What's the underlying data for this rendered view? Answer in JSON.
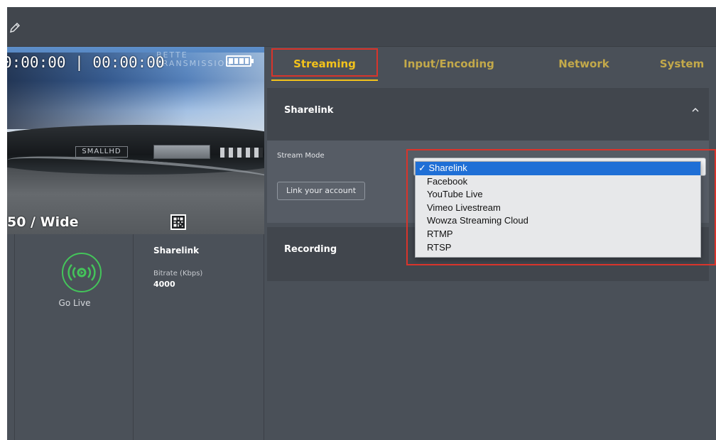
{
  "colors": {
    "accent": "#f2c21c",
    "tab_inactive": "#c3a94a",
    "live_green": "#44c45a",
    "highlight_red": "#d9342b",
    "selected_blue": "#1f6fd6"
  },
  "toolbar": {
    "edit_icon": "pencil-icon"
  },
  "preview": {
    "timecode": "0:00:00 | 00:00:00",
    "watermark": "BETTE  TRANSMISSION",
    "device_label": "SMALLHD",
    "lens_label": "50 / Wide",
    "battery_icon": "battery-icon",
    "qr_icon": "qr-code-icon"
  },
  "golive": {
    "label": "Go Live",
    "icon": "broadcast-icon"
  },
  "stream_info": {
    "title": "Sharelink",
    "bitrate_label": "Bitrate (Kbps)",
    "bitrate_value": "4000"
  },
  "tabs": [
    {
      "label": "Streaming",
      "active": true
    },
    {
      "label": "Input/Encoding",
      "active": false
    },
    {
      "label": "Network",
      "active": false
    },
    {
      "label": "System",
      "active": false
    }
  ],
  "sharelink_card": {
    "title": "Sharelink",
    "stream_mode_label": "Stream Mode",
    "link_button": "Link your account"
  },
  "recording_card": {
    "title": "Recording"
  },
  "stream_mode_dropdown": {
    "selected": "Sharelink",
    "options": [
      "✓ Sharelink",
      "Facebook",
      "YouTube Live",
      "Vimeo Livestream",
      "Wowza Streaming Cloud",
      "RTMP",
      "RTSP"
    ]
  }
}
